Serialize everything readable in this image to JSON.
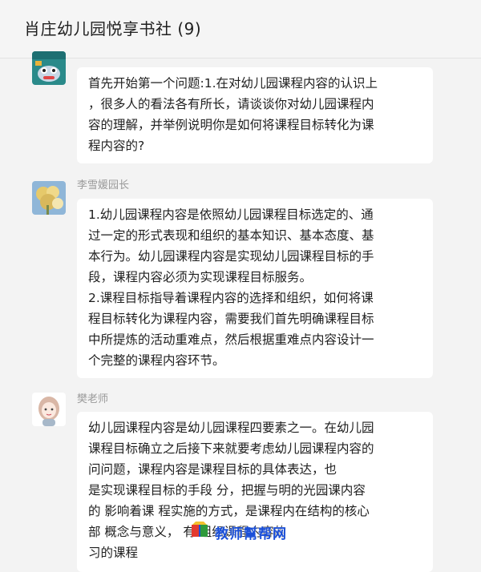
{
  "header": {
    "title": "肖庄幼儿园悦享书社 (9)"
  },
  "messages": [
    {
      "sender": "",
      "avatar": "cartoon-avatar-icon",
      "lines": [
        "首先开始第一个问题:1.在对幼儿园课程内容的认识上",
        "，很多人的看法各有所长，请谈谈你对幼儿园课程内",
        "容的理解，并举例说明你是如何将课程目标转化为课",
        "程内容的?"
      ]
    },
    {
      "sender": "李雪媛园长",
      "avatar": "flower-photo-avatar-icon",
      "lines": [
        "1.幼儿园课程内容是依照幼儿园课程目标选定的、通",
        "过一定的形式表现和组织的基本知识、基本态度、基",
        "本行为。幼儿园课程内容是实现幼儿园课程目标的手",
        "段，课程内容必须为实现课程目标服务。",
        "2.课程目标指导着课程内容的选择和组织，如何将课",
        "程目标转化为课程内容，需要我们首先明确课程目标",
        "中所提炼的活动重难点，然后根据重难点内容设计一",
        "个完整的课程内容环节。"
      ]
    },
    {
      "sender": "樊老师",
      "avatar": "cartoon-girl-avatar-icon",
      "lines": [
        "幼儿园课程内容是幼儿园课程四要素之一。在幼儿园",
        "课程目标确立之后接下来就要考虑幼儿园课程内容的",
        "问问题，课程内容是课程目标的具体表达，也",
        "是实现课程目标的手段 分，把握与明的光园课内容",
        "的 影响着课 程实施的方式，是课程内在结构的核心",
        "部 概念与意义，  有   组织课程内容的",
        "习的课程"
      ]
    }
  ],
  "watermark": {
    "text": "教师幫帮网",
    "icon": "book-logo-icon"
  }
}
